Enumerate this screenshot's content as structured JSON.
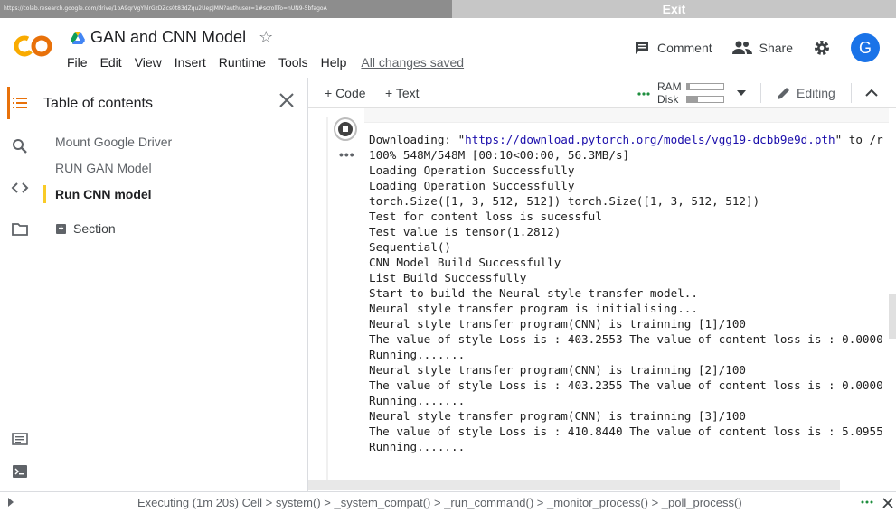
{
  "url_bar": {
    "url": "https://colab.research.google.com/drive/1bA9qrVgYhlrGzDZcs0t83dZqu2UepJMM?authuser=1#scrollTo=nUN9-5bfagoA",
    "exit_label": "Exit"
  },
  "header": {
    "title": "GAN and CNN Model",
    "menu": [
      "File",
      "Edit",
      "View",
      "Insert",
      "Runtime",
      "Tools",
      "Help"
    ],
    "saved_status": "All changes saved",
    "comment_label": "Comment",
    "share_label": "Share",
    "avatar_initial": "G",
    "avatar_color": "#1a73e8",
    "logo_color": "#f9ab00"
  },
  "toc": {
    "title": "Table of contents",
    "items": [
      {
        "label": "Mount Google Driver"
      },
      {
        "label": "RUN GAN Model"
      },
      {
        "label": "Run CNN model"
      }
    ],
    "section_label": "Section"
  },
  "toolbar": {
    "code_label": "+ Code",
    "text_label": "+ Text",
    "ram_label": "RAM",
    "disk_label": "Disk",
    "ram_level": 0.08,
    "disk_level": 0.3,
    "editing_label": "Editing"
  },
  "output": {
    "download_prefix": "Downloading: \"",
    "download_url": "https://download.pytorch.org/models/vgg19-dcbb9e9d.pth",
    "download_suffix": "\" to /r",
    "lines": [
      "100% 548M/548M [00:10<00:00, 56.3MB/s]",
      "Loading Operation Successfully",
      "Loading Operation Successfully",
      "torch.Size([1, 3, 512, 512]) torch.Size([1, 3, 512, 512])",
      "Test for content loss is sucessful",
      "Test value is tensor(1.2812)",
      "Sequential()",
      "CNN Model Build Successfully",
      "List Build Successfully",
      "Start to build the Neural style transfer model..",
      "Neural style transfer program is initialising...",
      "Neural style transfer program(CNN) is trainning [1]/100",
      "The value of style Loss is : 403.2553 The value of content loss is : 0.0000",
      "Running.......",
      "Neural style transfer program(CNN) is trainning [2]/100",
      "The value of style Loss is : 403.2355 The value of content loss is : 0.0000",
      "Running.......",
      "Neural style transfer program(CNN) is trainning [3]/100",
      "The value of style Loss is : 410.8440 The value of content loss is : 5.0955",
      "Running......."
    ]
  },
  "status": {
    "text": "Executing (1m 20s)  Cell > system() > _system_compat() > _run_command() > _monitor_process() > _poll_process()"
  },
  "icons": {
    "toc": "list-icon",
    "search": "search-icon",
    "code": "code-icon",
    "files": "folder-icon",
    "snippets": "snippets-icon",
    "terminal": "terminal-icon"
  }
}
